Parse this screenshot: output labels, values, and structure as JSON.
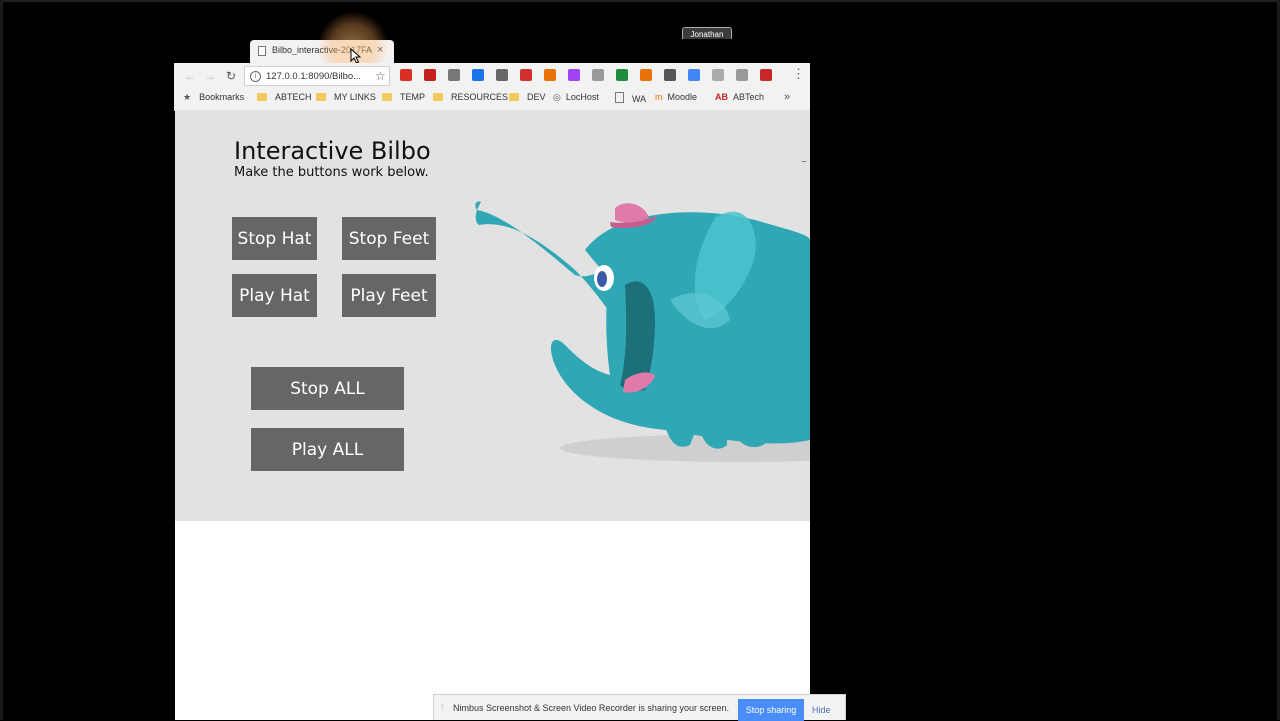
{
  "desktop": {
    "user_badge": "Jonathan"
  },
  "browser": {
    "tab_title": "Bilbo_interactive-2017FA",
    "tab_close": "×",
    "back": "←",
    "forward": "→",
    "reload": "↻",
    "url": "127.0.0.1:8090/Bilbo...",
    "star": "☆",
    "menu": "⋮",
    "bookmarks": [
      {
        "label": "Bookmarks",
        "icon": "star-icon"
      },
      {
        "label": "ABTECH",
        "icon": "folder-icon"
      },
      {
        "label": "MY LINKS",
        "icon": "folder-icon"
      },
      {
        "label": "TEMP",
        "icon": "folder-icon"
      },
      {
        "label": "RESOURCES",
        "icon": "folder-icon"
      },
      {
        "label": "DEV",
        "icon": "folder-icon"
      },
      {
        "label": "LocHost",
        "icon": "globe-icon"
      },
      {
        "label": "WA",
        "icon": "page-icon"
      },
      {
        "label": "Moodle",
        "icon": "moodle-icon"
      },
      {
        "label": "ABTech",
        "icon": "abtech-icon"
      }
    ],
    "bookmarks_more": "»",
    "extension_colors": [
      "#d93025",
      "#c5221f",
      "#777",
      "#1a73e8",
      "#666",
      "#d32f2f",
      "#e8710a",
      "#a142f4",
      "#999",
      "#1e8e3e",
      "#e8710a",
      "#555",
      "#4285f4",
      "#aaa",
      "#999",
      "#c62828"
    ]
  },
  "page": {
    "title": "Interactive Bilbo",
    "subtitle": "Make the buttons work below.",
    "stray_glyph": "~",
    "buttons": {
      "stop_hat": "Stop Hat",
      "stop_feet": "Stop Feet",
      "play_hat": "Play Hat",
      "play_feet": "Play Feet",
      "stop_all": "Stop ALL",
      "play_all": "Play ALL"
    },
    "colors": {
      "stage_bg": "#e2e2e2",
      "button_bg": "#666666",
      "elephant": "#2fa7b5",
      "hat": "#e07aa8"
    }
  },
  "share_bar": {
    "grip": "⁞",
    "message": "Nimbus Screenshot & Screen Video Recorder is sharing your screen.",
    "stop_label": "Stop sharing",
    "hide_label": "Hide"
  }
}
